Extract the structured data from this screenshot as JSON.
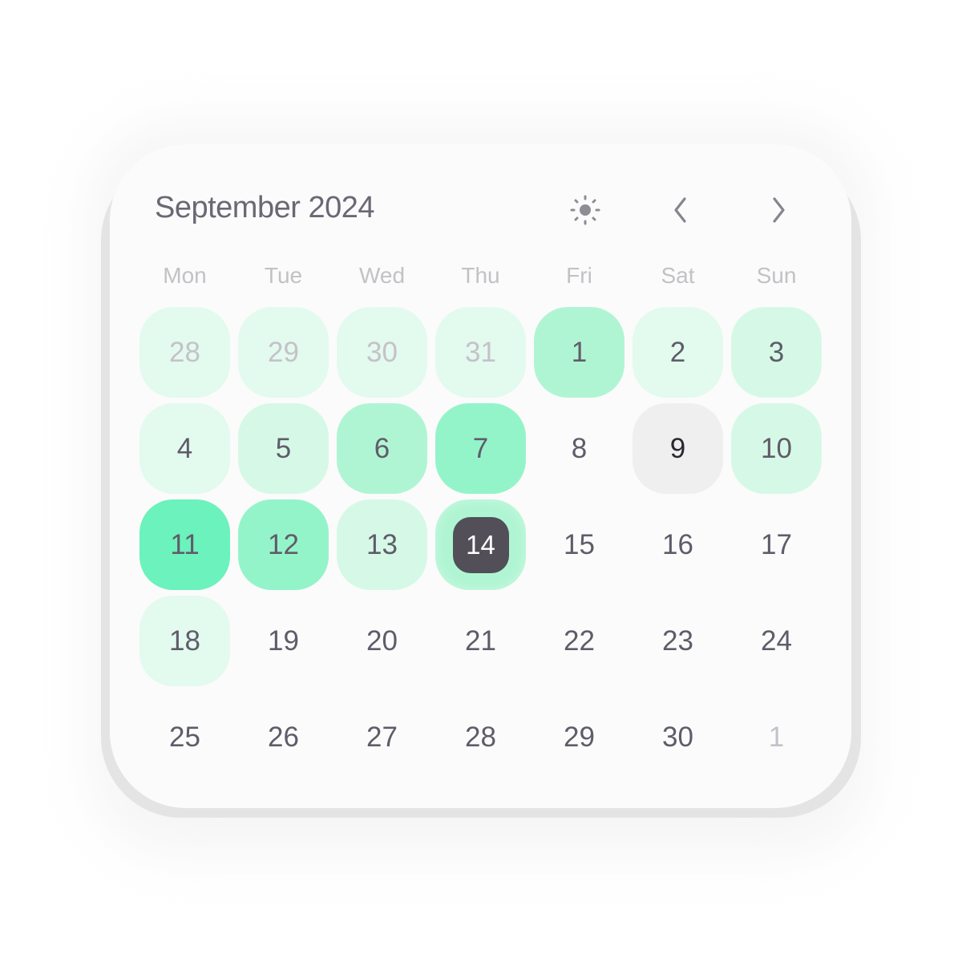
{
  "header": {
    "title": "September 2024",
    "theme_toggle_icon": "sun-icon",
    "prev_icon": "chevron-left-icon",
    "next_icon": "chevron-right-icon"
  },
  "weekdays": [
    "Mon",
    "Tue",
    "Wed",
    "Thu",
    "Fri",
    "Sat",
    "Sun"
  ],
  "level_colors": {
    "0": "transparent",
    "1": "#e3faef",
    "2": "#d6f9e7",
    "3": "#b0f5d3",
    "4": "#94f4c9",
    "5": "#6cf2bc",
    "grey": "#efefef"
  },
  "colors": {
    "today_bg": "#524f58",
    "today_ring": "#b0f5d3",
    "text": "#5f5c69",
    "muted_text": "#c4c2c8"
  },
  "today": 14,
  "weeks": [
    [
      {
        "day": "28",
        "outside": true,
        "level": "1"
      },
      {
        "day": "29",
        "outside": true,
        "level": "1"
      },
      {
        "day": "30",
        "outside": true,
        "level": "1"
      },
      {
        "day": "31",
        "outside": true,
        "level": "1"
      },
      {
        "day": "1",
        "level": "3"
      },
      {
        "day": "2",
        "level": "1"
      },
      {
        "day": "3",
        "level": "2"
      }
    ],
    [
      {
        "day": "4",
        "level": "1"
      },
      {
        "day": "5",
        "level": "2"
      },
      {
        "day": "6",
        "level": "3"
      },
      {
        "day": "7",
        "level": "4"
      },
      {
        "day": "8",
        "level": "0"
      },
      {
        "day": "9",
        "level": "grey",
        "emphasis": true
      },
      {
        "day": "10",
        "level": "2"
      }
    ],
    [
      {
        "day": "11",
        "level": "5"
      },
      {
        "day": "12",
        "level": "4"
      },
      {
        "day": "13",
        "level": "2"
      },
      {
        "day": "14",
        "level": "3",
        "today": true
      },
      {
        "day": "15",
        "level": "0"
      },
      {
        "day": "16",
        "level": "0"
      },
      {
        "day": "17",
        "level": "0"
      }
    ],
    [
      {
        "day": "18",
        "level": "1"
      },
      {
        "day": "19",
        "level": "0"
      },
      {
        "day": "20",
        "level": "0"
      },
      {
        "day": "21",
        "level": "0"
      },
      {
        "day": "22",
        "level": "0"
      },
      {
        "day": "23",
        "level": "0"
      },
      {
        "day": "24",
        "level": "0"
      }
    ],
    [
      {
        "day": "25",
        "level": "0"
      },
      {
        "day": "26",
        "level": "0"
      },
      {
        "day": "27",
        "level": "0"
      },
      {
        "day": "28",
        "level": "0"
      },
      {
        "day": "29",
        "level": "0"
      },
      {
        "day": "30",
        "level": "0"
      },
      {
        "day": "1",
        "outside": true,
        "level": "0"
      }
    ]
  ]
}
